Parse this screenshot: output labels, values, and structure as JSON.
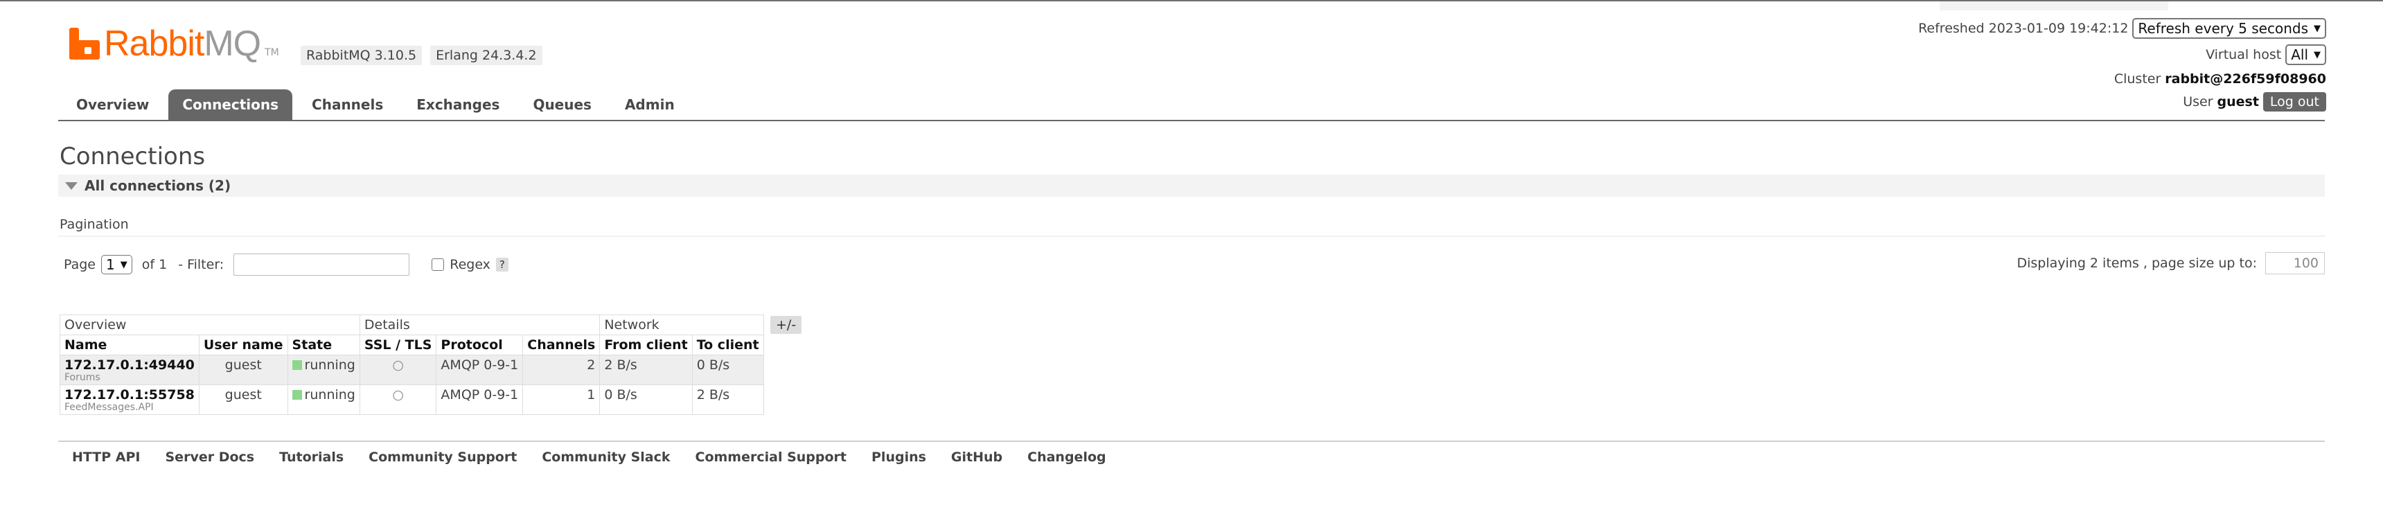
{
  "brand": {
    "rabbit": "Rabbit",
    "mq": "MQ",
    "tm": "TM"
  },
  "versions": {
    "rabbitmq": "RabbitMQ 3.10.5",
    "erlang": "Erlang 24.3.4.2"
  },
  "header": {
    "refreshed": "Refreshed 2023-01-09 19:42:12",
    "refresh_select": "Refresh every 5 seconds",
    "vhost_label": "Virtual host",
    "vhost_select": "All",
    "cluster_label": "Cluster",
    "cluster_name": "rabbit@226f59f08960",
    "user_label": "User",
    "user_name": "guest",
    "logout": "Log out"
  },
  "nav": {
    "tabs": [
      "Overview",
      "Connections",
      "Channels",
      "Exchanges",
      "Queues",
      "Admin"
    ],
    "active": "Connections"
  },
  "page_title": "Connections",
  "section": {
    "title": "All connections (2)"
  },
  "pagination": {
    "label": "Pagination",
    "page_label": "Page",
    "page_value": "1",
    "of": "of 1",
    "filter_label": "- Filter:",
    "regex_label": "Regex",
    "help": "?",
    "displaying": "Displaying 2 items , page size up to:",
    "page_size": "100"
  },
  "table": {
    "groups": [
      "Overview",
      "Details",
      "Network"
    ],
    "columns": [
      "Name",
      "User name",
      "State",
      "SSL / TLS",
      "Protocol",
      "Channels",
      "From client",
      "To client"
    ],
    "plus_minus": "+/-",
    "rows": [
      {
        "name": "172.17.0.1:49440",
        "sub": "Forums",
        "user": "guest",
        "state": "running",
        "ssl": "○",
        "protocol": "AMQP 0-9-1",
        "channels": "2",
        "from_client": "2 B/s",
        "to_client": "0 B/s"
      },
      {
        "name": "172.17.0.1:55758",
        "sub": "FeedMessages.API",
        "user": "guest",
        "state": "running",
        "ssl": "○",
        "protocol": "AMQP 0-9-1",
        "channels": "1",
        "from_client": "0 B/s",
        "to_client": "2 B/s"
      }
    ]
  },
  "footer": {
    "links": [
      "HTTP API",
      "Server Docs",
      "Tutorials",
      "Community Support",
      "Community Slack",
      "Commercial Support",
      "Plugins",
      "GitHub",
      "Changelog"
    ]
  },
  "colors": {
    "brand": "#ff6600",
    "active_tab": "#666666",
    "running": "#8ed68c"
  }
}
